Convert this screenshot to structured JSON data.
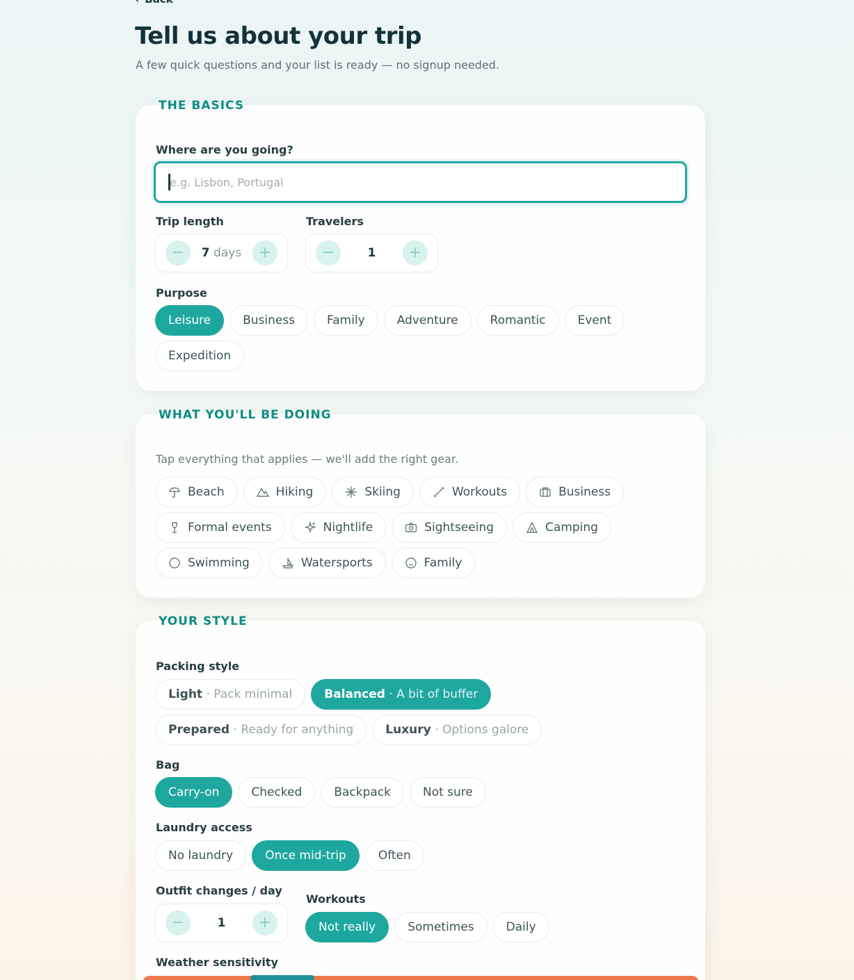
{
  "nav": {
    "back_label": "Back"
  },
  "header": {
    "title": "Tell us about your trip",
    "subtitle": "A few quick questions and your list is ready — no signup needed."
  },
  "basics": {
    "section_title": "THE BASICS",
    "destination_label": "Where are you going?",
    "destination_value": "",
    "destination_placeholder": "e.g. Lisbon, Portugal",
    "trip_length_label": "Trip length",
    "trip_length_value": "7",
    "trip_length_unit": "days",
    "travelers_label": "Travelers",
    "travelers_value": "1",
    "purpose_label": "Purpose",
    "purposes": [
      {
        "label": "Leisure",
        "selected": true
      },
      {
        "label": "Business",
        "selected": false
      },
      {
        "label": "Family",
        "selected": false
      },
      {
        "label": "Adventure",
        "selected": false
      },
      {
        "label": "Romantic",
        "selected": false
      },
      {
        "label": "Event",
        "selected": false
      },
      {
        "label": "Expedition",
        "selected": false
      }
    ]
  },
  "activities": {
    "section_title": "WHAT YOU'LL BE DOING",
    "hint": "Tap everything that applies — we'll add the right gear.",
    "items": [
      {
        "label": "Beach",
        "icon": "umbrella-icon"
      },
      {
        "label": "Hiking",
        "icon": "mountain-icon"
      },
      {
        "label": "Skiing",
        "icon": "snowflake-icon"
      },
      {
        "label": "Workouts",
        "icon": "dumbbell-icon"
      },
      {
        "label": "Business",
        "icon": "briefcase-icon"
      },
      {
        "label": "Formal events",
        "icon": "wine-glass-icon"
      },
      {
        "label": "Nightlife",
        "icon": "sparkles-icon"
      },
      {
        "label": "Sightseeing",
        "icon": "camera-icon"
      },
      {
        "label": "Camping",
        "icon": "tent-icon"
      },
      {
        "label": "Swimming",
        "icon": "circle-icon"
      },
      {
        "label": "Watersports",
        "icon": "sailboat-icon"
      },
      {
        "label": "Family",
        "icon": "baby-icon"
      }
    ]
  },
  "style": {
    "section_title": "YOUR STYLE",
    "packing_label": "Packing style",
    "packing_options": [
      {
        "label": "Light",
        "sub": "Pack minimal",
        "selected": false
      },
      {
        "label": "Balanced",
        "sub": "A bit of buffer",
        "selected": true
      },
      {
        "label": "Prepared",
        "sub": "Ready for anything",
        "selected": false
      },
      {
        "label": "Luxury",
        "sub": "Options galore",
        "selected": false
      }
    ],
    "separator": "·",
    "bag_label": "Bag",
    "bag_options": [
      {
        "label": "Carry-on",
        "selected": true
      },
      {
        "label": "Checked",
        "selected": false
      },
      {
        "label": "Backpack",
        "selected": false
      },
      {
        "label": "Not sure",
        "selected": false
      }
    ],
    "laundry_label": "Laundry access",
    "laundry_options": [
      {
        "label": "No laundry",
        "selected": false
      },
      {
        "label": "Once mid-trip",
        "selected": true
      },
      {
        "label": "Often",
        "selected": false
      }
    ],
    "outfit_label": "Outfit changes / day",
    "outfit_value": "1",
    "workouts_label": "Workouts",
    "workouts_options": [
      {
        "label": "Not really",
        "selected": true
      },
      {
        "label": "Sometimes",
        "selected": false
      },
      {
        "label": "Daily",
        "selected": false
      }
    ],
    "weather_label": "Weather sensitivity"
  },
  "colors": {
    "accent": "#1ea79f",
    "section_title": "#0f8c86",
    "cta": "#ee7a4c"
  }
}
